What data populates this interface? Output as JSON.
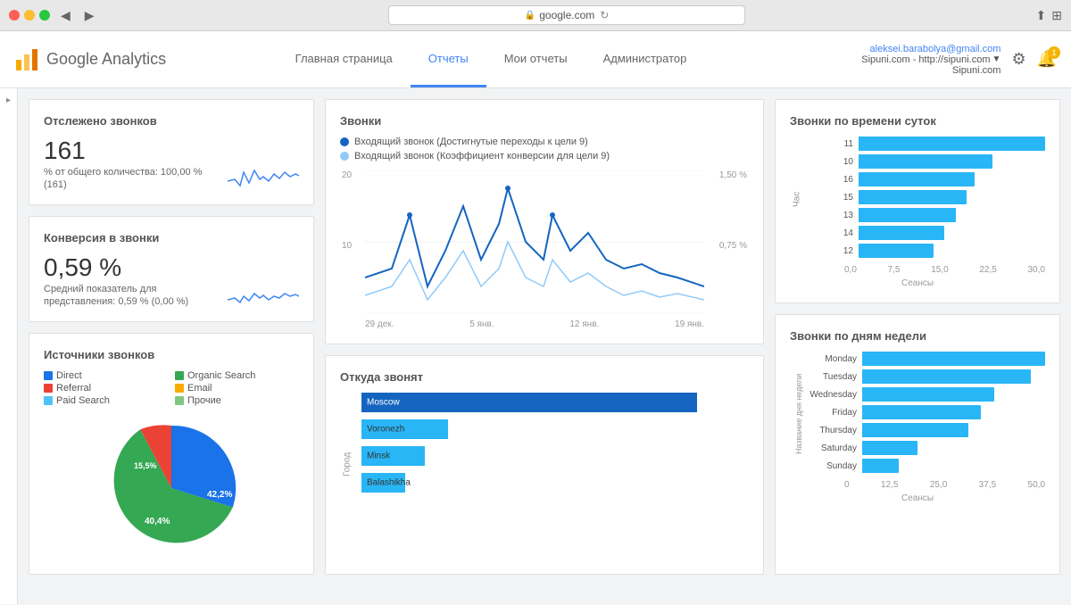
{
  "browser": {
    "url": "google.com",
    "back_btn": "◀",
    "forward_btn": "▶",
    "refresh_icon": "↻"
  },
  "header": {
    "logo_text": "Google Analytics",
    "nav": {
      "home": "Главная страница",
      "reports": "Отчеты",
      "my_reports": "Мои отчеты",
      "admin": "Администратор"
    },
    "user": {
      "email": "aleksei.barabolya@gmail.com",
      "site_label": "Sipuni.com - http://sipuni.com",
      "site_name": "Sipuni.com"
    },
    "notification_count": "1"
  },
  "cards": {
    "calls_tracked": {
      "title": "Отслежено звонков",
      "value": "161",
      "sub1": "% от общего количества: 100,00 %",
      "sub2": "(161)"
    },
    "conversion": {
      "title": "Конверсия в звонки",
      "value": "0,59 %",
      "sub1": "Средний показатель для",
      "sub2": "представления: 0,59 % (0,00 %)"
    },
    "sources": {
      "title": "Источники звонков",
      "legend": [
        {
          "label": "Direct",
          "color": "#1a73e8"
        },
        {
          "label": "Organic Search",
          "color": "#34a853"
        },
        {
          "label": "Referral",
          "color": "#ea4335"
        },
        {
          "label": "Email",
          "color": "#f9ab00"
        },
        {
          "label": "Paid Search",
          "color": "#4fc3f7"
        },
        {
          "label": "Прочие",
          "color": "#81c784"
        }
      ],
      "pie_data": [
        {
          "label": "Direct",
          "pct": 42.2,
          "color": "#1a73e8"
        },
        {
          "label": "Organic",
          "pct": 40.4,
          "color": "#34a853"
        },
        {
          "label": "Referral",
          "pct": 15.5,
          "color": "#ea4335"
        },
        {
          "label": "Other",
          "pct": 1.9,
          "color": "#f9ab00"
        }
      ]
    },
    "calls_chart": {
      "title": "Звонки",
      "legend1": "Входящий звонок (Достигнутые переходы к цели 9)",
      "legend2": "Входящий звонок (Коэффициент конверсии для цели 9)",
      "y_left_max": "20",
      "y_right_max": "1,50 %",
      "y_right_mid": "0,75 %",
      "x_labels": [
        "29 дек.",
        "5 янв.",
        "12 янв.",
        "19 янв."
      ]
    },
    "calls_source": {
      "title": "Откуда звонят",
      "y_axis_label": "Город",
      "cities": [
        {
          "name": "Moscow",
          "pct": 85
        },
        {
          "name": "Voronezh",
          "pct": 18
        },
        {
          "name": "Minsk",
          "pct": 14
        },
        {
          "name": "Balashikha",
          "pct": 10
        }
      ]
    },
    "calls_by_time": {
      "title": "Звонки по времени суток",
      "y_axis_label": "Час",
      "x_axis_label": "Сеансы",
      "x_labels": [
        "0,0",
        "7,5",
        "15,0",
        "22,5",
        "30,0"
      ],
      "bars": [
        {
          "label": "11",
          "pct": 100
        },
        {
          "label": "10",
          "pct": 72
        },
        {
          "label": "16",
          "pct": 62
        },
        {
          "label": "15",
          "pct": 58
        },
        {
          "label": "13",
          "pct": 52
        },
        {
          "label": "14",
          "pct": 46
        },
        {
          "label": "12",
          "pct": 40
        }
      ]
    },
    "calls_by_weekday": {
      "title": "Звонки по дням недели",
      "y_axis_label": "Название дня недели",
      "x_axis_label": "Сеансы",
      "x_labels": [
        "0",
        "12,5",
        "25,0",
        "37,5",
        "50,0"
      ],
      "bars": [
        {
          "label": "Monday",
          "pct": 100
        },
        {
          "label": "Tuesday",
          "pct": 92
        },
        {
          "label": "Wednesday",
          "pct": 72
        },
        {
          "label": "Friday",
          "pct": 65
        },
        {
          "label": "Thursday",
          "pct": 58
        },
        {
          "label": "Saturday",
          "pct": 30
        },
        {
          "label": "Sunday",
          "pct": 20
        }
      ]
    }
  }
}
